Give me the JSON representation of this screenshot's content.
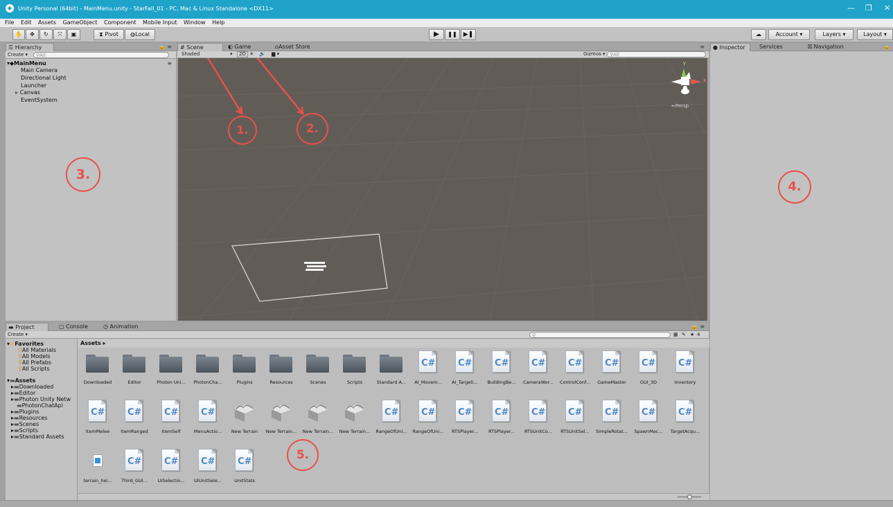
{
  "window": {
    "title": "Unity Personal (64bit) - MainMenu.unity - StarFall_01 - PC, Mac & Linux Standalone <DX11>"
  },
  "menu": [
    "File",
    "Edit",
    "Assets",
    "GameObject",
    "Component",
    "Mobile Input",
    "Window",
    "Help"
  ],
  "toolbar": {
    "pivot": "Pivot",
    "local": "Local",
    "account": "Account",
    "layers": "Layers",
    "layout": "Layout"
  },
  "hierarchy": {
    "tab": "Hierarchy",
    "create": "Create",
    "search_placeholder": "All",
    "scene": "MainMenu",
    "items": [
      "Main Camera",
      "Directional Light",
      "Launcher",
      "Canvas",
      "EventSystem"
    ]
  },
  "scene_view": {
    "tabs": [
      "Scene",
      "Game",
      "Asset Store"
    ],
    "shading": "Shaded",
    "mode_2d": "2D",
    "gizmos": "Gizmos",
    "search_placeholder": "All",
    "gizmo": {
      "y": "y",
      "x": "x",
      "persp": "Persp"
    }
  },
  "inspector": {
    "tabs": [
      "Inspector",
      "Services",
      "Navigation"
    ]
  },
  "project": {
    "tabs": [
      "Project",
      "Console",
      "Animation"
    ],
    "create": "Create",
    "breadcrumb": "Assets",
    "count": "4",
    "favorites": {
      "label": "Favorites",
      "items": [
        "All Materials",
        "All Models",
        "All Prefabs",
        "All Scripts"
      ]
    },
    "assets_tree": {
      "label": "Assets",
      "items": [
        "Downloaded",
        "Editor",
        "Photon Unity Netw",
        "PhotonChatApi",
        "Plugins",
        "Resources",
        "Scenes",
        "Scripts",
        "Standard Assets"
      ]
    },
    "grid": [
      {
        "label": "Downloaded",
        "type": "folder"
      },
      {
        "label": "Editor",
        "type": "folder"
      },
      {
        "label": "Photon Uni...",
        "type": "folder"
      },
      {
        "label": "PhotonCha...",
        "type": "folder"
      },
      {
        "label": "Plugins",
        "type": "folder"
      },
      {
        "label": "Resources",
        "type": "folder"
      },
      {
        "label": "Scenes",
        "type": "folder"
      },
      {
        "label": "Scripts",
        "type": "folder"
      },
      {
        "label": "Standard A...",
        "type": "folder"
      },
      {
        "label": "AI_Movem...",
        "type": "script"
      },
      {
        "label": "AI_Targeti...",
        "type": "script"
      },
      {
        "label": "BuildingBe...",
        "type": "script"
      },
      {
        "label": "CameraWor...",
        "type": "script"
      },
      {
        "label": "ControlConf...",
        "type": "script"
      },
      {
        "label": "GameMaster",
        "type": "script"
      },
      {
        "label": "GUI_3D",
        "type": "script"
      },
      {
        "label": "Inventory",
        "type": "script"
      },
      {
        "label": "ItemMelee",
        "type": "script"
      },
      {
        "label": "ItemRanged",
        "type": "script"
      },
      {
        "label": "ItemSelf",
        "type": "script"
      },
      {
        "label": "MenuActio...",
        "type": "script"
      },
      {
        "label": "New Terrain",
        "type": "terrain"
      },
      {
        "label": "New Terrain...",
        "type": "terrain"
      },
      {
        "label": "New Terrain...",
        "type": "terrain"
      },
      {
        "label": "New Terrain...",
        "type": "terrain"
      },
      {
        "label": "RangeOfUni...",
        "type": "script"
      },
      {
        "label": "RangeOfUni...",
        "type": "script"
      },
      {
        "label": "RTSPlayer...",
        "type": "script"
      },
      {
        "label": "RTSPlayer...",
        "type": "script"
      },
      {
        "label": "RTSUnitCo...",
        "type": "script"
      },
      {
        "label": "RTSUnitSel...",
        "type": "script"
      },
      {
        "label": "SimpleRotat...",
        "type": "script"
      },
      {
        "label": "SpawnMec...",
        "type": "script"
      },
      {
        "label": "TargetAcqu...",
        "type": "script"
      },
      {
        "label": "terrain_hei...",
        "type": "image"
      },
      {
        "label": "Third_GUI...",
        "type": "script"
      },
      {
        "label": "UISelectio...",
        "type": "script"
      },
      {
        "label": "UIUnitSele...",
        "type": "script"
      },
      {
        "label": "UnitStats",
        "type": "script"
      }
    ]
  },
  "annotations": [
    "1.",
    "2.",
    "3.",
    "4.",
    "5."
  ],
  "colors": {
    "title_bar": "#1fa3c9",
    "annotation": "#e8514a",
    "scene_bg": "#625c57",
    "panel": "#c2c2c2"
  },
  "icons": {
    "script_glyph": "C#"
  }
}
